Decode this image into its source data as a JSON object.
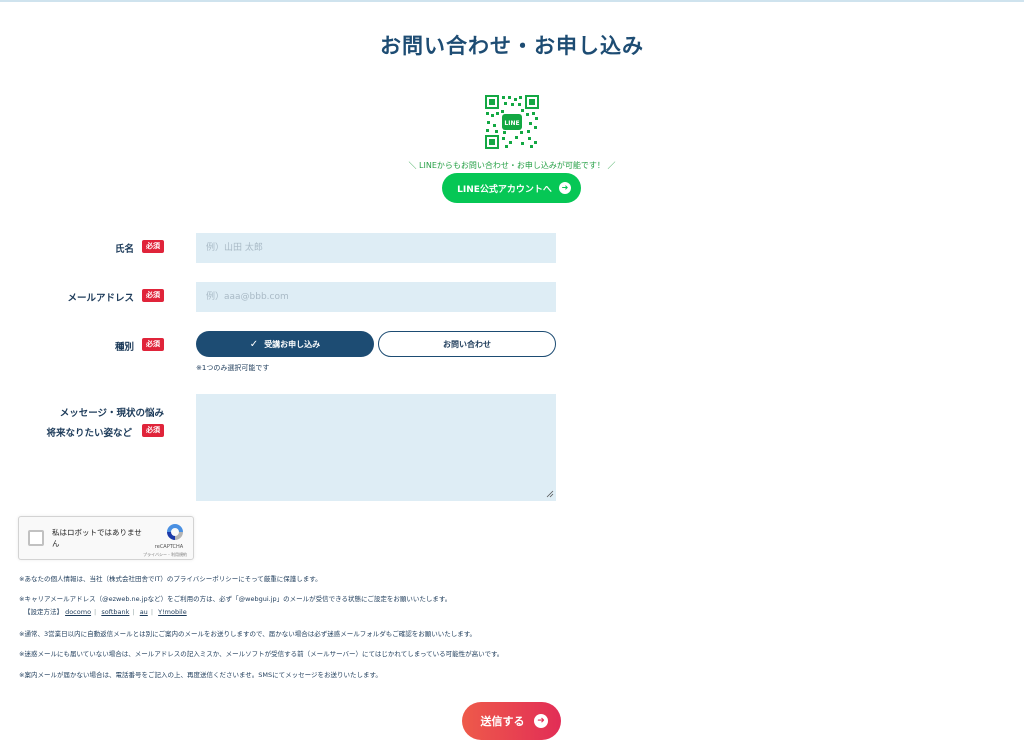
{
  "page": {
    "title": "お問い合わせ・お申し込み"
  },
  "line": {
    "qr_icon": "line-qr-code-icon",
    "qr_logo_text": "LINE",
    "caption": "＼ LINEからもお問い合わせ・お申し込みが可能です！ ／",
    "button_label": "LINE公式アカウントへ",
    "button_color": "#06c755"
  },
  "form": {
    "required_badge": "必須",
    "name": {
      "label": "氏名",
      "placeholder": "例）山田 太郎",
      "value": ""
    },
    "email": {
      "label": "メールアドレス",
      "placeholder": "例）aaa@bbb.com",
      "value": ""
    },
    "type": {
      "label": "種別",
      "options": [
        {
          "label": "受講お申し込み",
          "selected": true
        },
        {
          "label": "お問い合わせ",
          "selected": false
        }
      ],
      "hint": "※1つのみ選択可能です"
    },
    "message": {
      "label_line1": "メッセージ・現状の悩み",
      "label_line2": "将来なりたい姿など",
      "value": ""
    }
  },
  "recaptcha": {
    "label": "私はロボットではありません",
    "brand": "reCAPTCHA",
    "terms": "プライバシー - 利用規約"
  },
  "notes": {
    "privacy": "※あなたの個人情報は、当社（株式会社田舎でIT）のプライバシーポリシーにそって厳重に保護します。",
    "carrier": "※キャリアメールアドレス（@ezweb.ne.jpなど）をご利用の方は、必ず「@webgui.jp」のメールが受信できる状態にご設定をお願いいたします。",
    "settings_prefix": "【設定方法】",
    "carrier_links": [
      "docomo",
      "softbank",
      "au",
      "Y!mobile"
    ],
    "auto_reply": "※通常、3営業日以内に自動返信メールとは別にご案内のメールをお送りしますので、届かない場合は必ず迷惑メールフォルダもご確認をお願いいたします。",
    "spam": "※迷惑メールにも届いていない場合は、メールアドレスの記入ミスか、メールソフトが受信する前（メールサーバー）にてはじかれてしまっている可能性が高いです。",
    "sms": "※案内メールが届かない場合は、電話番号をご記入の上、再度送信くださいませ。SMSにてメッセージをお送りいたします。"
  },
  "submit": {
    "label": "送信する",
    "arrow_icon": "arrow-circle-icon"
  }
}
